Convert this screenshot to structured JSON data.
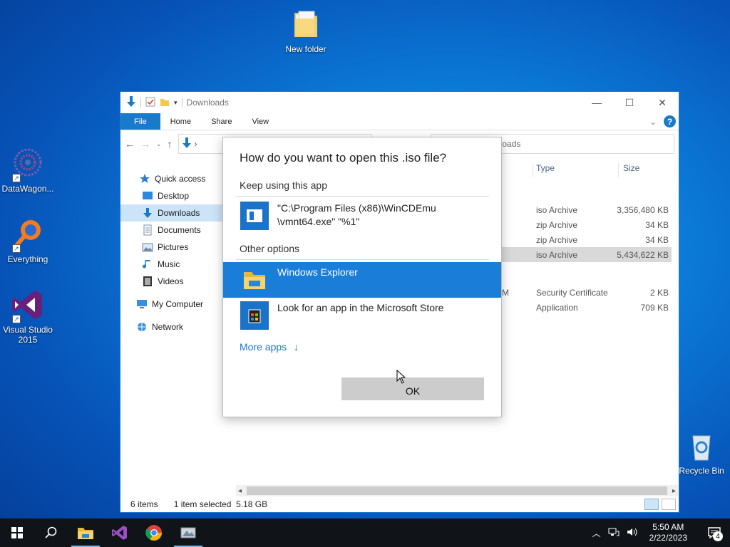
{
  "desktop": {
    "icons": [
      {
        "label": "New folder",
        "icon": "folder-icon"
      },
      {
        "label": "DataWagon...",
        "icon": "datawagon-icon"
      },
      {
        "label": "Everything",
        "icon": "everything-search-icon"
      },
      {
        "label": "Visual Studio 2015",
        "icon": "visual-studio-icon"
      },
      {
        "label": "Recycle Bin",
        "icon": "recycle-bin-icon"
      }
    ]
  },
  "explorer": {
    "title": "Downloads",
    "ribbon_tabs": [
      "File",
      "Home",
      "Share",
      "View"
    ],
    "search_placeholder": "nloads",
    "sidebar": [
      {
        "label": "Quick access",
        "icon": "star-icon"
      },
      {
        "label": "Desktop",
        "icon": "desktop-icon"
      },
      {
        "label": "Downloads",
        "icon": "download-icon",
        "selected": true
      },
      {
        "label": "Documents",
        "icon": "documents-icon"
      },
      {
        "label": "Pictures",
        "icon": "pictures-icon"
      },
      {
        "label": "Music",
        "icon": "music-icon"
      },
      {
        "label": "Videos",
        "icon": "videos-icon"
      },
      {
        "label": "My Computer",
        "icon": "computer-icon"
      },
      {
        "label": "Network",
        "icon": "network-icon"
      }
    ],
    "columns": {
      "type": "Type",
      "size": "Size"
    },
    "rows": [
      {
        "name_fragment": "",
        "type": "iso Archive",
        "size": "3,356,480 KB"
      },
      {
        "name_fragment": "",
        "type": "zip Archive",
        "size": "34 KB"
      },
      {
        "name_fragment": "",
        "type": "zip Archive",
        "size": "34 KB"
      },
      {
        "name_fragment": "",
        "type": "iso Archive",
        "size": "5,434,622 KB",
        "selected": true
      },
      {
        "name_fragment": "M",
        "type": "Security Certificate",
        "size": "2 KB"
      },
      {
        "name_fragment": "",
        "type": "Application",
        "size": "709 KB"
      }
    ],
    "status": {
      "items": "6 items",
      "selected": "1 item selected",
      "selected_size": "5.18 GB"
    }
  },
  "dialog": {
    "title": "How do you want to open this .iso file?",
    "keep_using_label": "Keep using this app",
    "current_app": "\"C:\\Program Files (x86)\\WinCDEmu\n\\vmnt64.exe\" \"%1\"",
    "current_app_line1": "\"C:\\Program Files (x86)\\WinCDEmu",
    "current_app_line2": "\\vmnt64.exe\" \"%1\"",
    "other_options_label": "Other options",
    "options": [
      {
        "label": "Windows Explorer",
        "icon": "file-explorer-icon",
        "selected": true
      },
      {
        "label": "Look for an app in the Microsoft Store",
        "icon": "microsoft-store-icon",
        "selected": false
      }
    ],
    "more_apps": "More apps",
    "ok_label": "OK"
  },
  "taskbar": {
    "time": "5:50 AM",
    "date": "2/22/2023",
    "notifications": "4",
    "pinned": [
      "file-explorer-icon",
      "visual-studio-icon",
      "chrome-icon",
      "wincdemu-icon"
    ]
  },
  "colors": {
    "accent": "#1a7dd7",
    "taskbar": "#101317",
    "selection": "#cce4f7"
  }
}
